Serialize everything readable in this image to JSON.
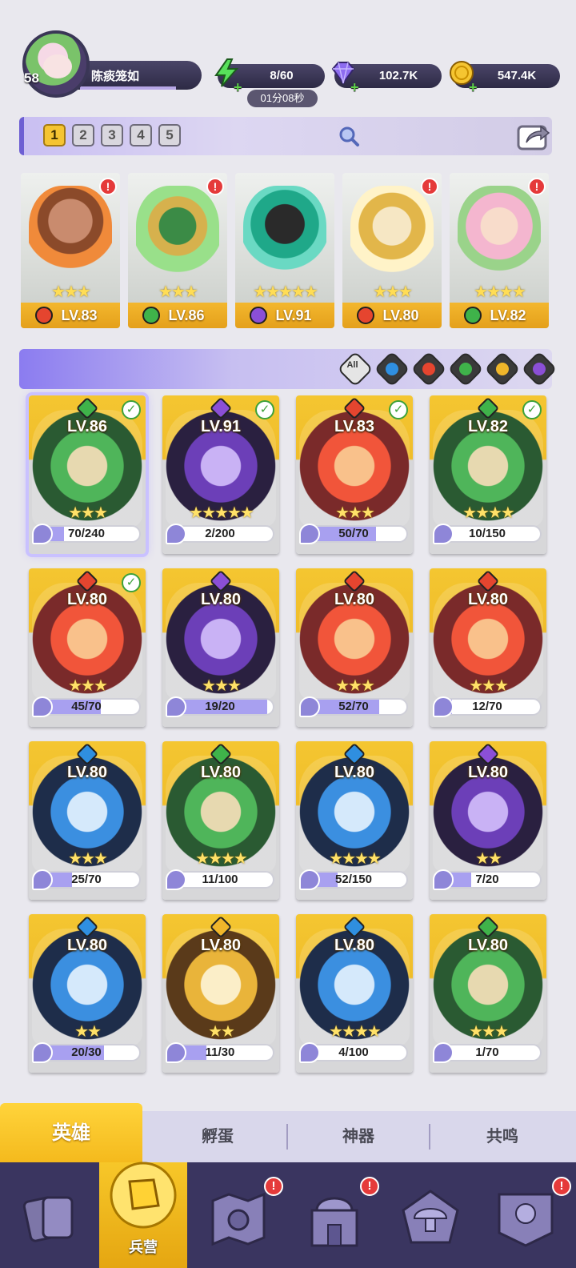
{
  "player": {
    "level": "58",
    "name": "陈痰笼如"
  },
  "resources": {
    "energy": "8/60",
    "energy_timer": "01分08秒",
    "gems": "102.7K",
    "gold": "547.4K"
  },
  "team_tabs": [
    "1",
    "2",
    "3",
    "4",
    "5"
  ],
  "active_team_tab": "1",
  "team": [
    {
      "level": "LV.83",
      "element": "fire",
      "stars": "★★★",
      "alert": "!"
    },
    {
      "level": "LV.86",
      "element": "nature",
      "stars": "★★★",
      "alert": "!"
    },
    {
      "level": "LV.91",
      "element": "dark",
      "stars": "★★★★★",
      "alert": ""
    },
    {
      "level": "LV.80",
      "element": "fire",
      "stars": "★★★",
      "alert": "!"
    },
    {
      "level": "LV.82",
      "element": "nature",
      "stars": "★★★★",
      "alert": "!"
    }
  ],
  "filter_all_label": "All",
  "filters": [
    "water",
    "fire",
    "nature",
    "light",
    "dark"
  ],
  "colors": {
    "fire": "#e5452f",
    "nature": "#3fb34a",
    "dark": "#8b4fd6",
    "water": "#2f8fe0",
    "light": "#f0b62a",
    "accent": "#f4c631"
  },
  "heroes": [
    {
      "level": "LV.86",
      "element": "nature",
      "stars": "★★★",
      "shards": "70/240",
      "progress": 0.29,
      "checked": "✓",
      "selected": true
    },
    {
      "level": "LV.91",
      "element": "dark",
      "stars": "★★★★★",
      "shards": "2/200",
      "progress": 0.01,
      "checked": "✓"
    },
    {
      "level": "LV.83",
      "element": "fire",
      "stars": "★★★",
      "shards": "50/70",
      "progress": 0.71,
      "checked": "✓"
    },
    {
      "level": "LV.82",
      "element": "nature",
      "stars": "★★★★",
      "shards": "10/150",
      "progress": 0.07,
      "checked": "✓"
    },
    {
      "level": "LV.80",
      "element": "fire",
      "stars": "★★★",
      "shards": "45/70",
      "progress": 0.64,
      "checked": "✓"
    },
    {
      "level": "LV.80",
      "element": "dark",
      "stars": "★★★",
      "shards": "19/20",
      "progress": 0.95,
      "checked": ""
    },
    {
      "level": "LV.80",
      "element": "fire",
      "stars": "★★★",
      "shards": "52/70",
      "progress": 0.74,
      "checked": ""
    },
    {
      "level": "LV.80",
      "element": "fire",
      "stars": "★★★",
      "shards": "12/70",
      "progress": 0.17,
      "checked": ""
    },
    {
      "level": "LV.80",
      "element": "water",
      "stars": "★★★",
      "shards": "25/70",
      "progress": 0.36,
      "checked": ""
    },
    {
      "level": "LV.80",
      "element": "nature",
      "stars": "★★★★",
      "shards": "11/100",
      "progress": 0.11,
      "checked": ""
    },
    {
      "level": "LV.80",
      "element": "water",
      "stars": "★★★★",
      "shards": "52/150",
      "progress": 0.35,
      "checked": ""
    },
    {
      "level": "LV.80",
      "element": "dark",
      "stars": "★★",
      "shards": "7/20",
      "progress": 0.35,
      "checked": ""
    },
    {
      "level": "LV.80",
      "element": "water",
      "stars": "★★",
      "shards": "20/30",
      "progress": 0.67,
      "checked": ""
    },
    {
      "level": "LV.80",
      "element": "light",
      "stars": "★★",
      "shards": "11/30",
      "progress": 0.37,
      "checked": ""
    },
    {
      "level": "LV.80",
      "element": "water",
      "stars": "★★★★",
      "shards": "4/100",
      "progress": 0.04,
      "checked": ""
    },
    {
      "level": "LV.80",
      "element": "nature",
      "stars": "★★★",
      "shards": "1/70",
      "progress": 0.01,
      "checked": ""
    }
  ],
  "subtabs": [
    "英雄",
    "孵蛋",
    "神器",
    "共鸣"
  ],
  "nav": {
    "barracks_label": "兵营",
    "alert": "!"
  }
}
